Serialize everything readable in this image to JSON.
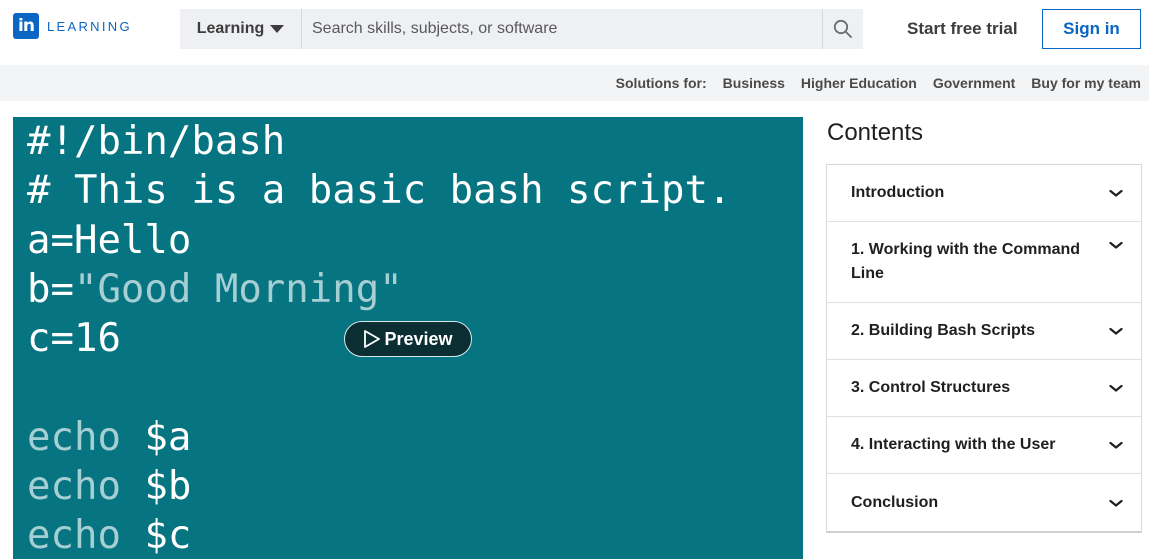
{
  "brand": {
    "logo_mark": "in",
    "logo_word": "LEARNING",
    "accent": "#0a66c2"
  },
  "search": {
    "category": "Learning",
    "placeholder": "Search skills, subjects, or software",
    "icon": "search-icon"
  },
  "header": {
    "start_trial": "Start free trial",
    "sign_in": "Sign in"
  },
  "solutions": {
    "label": "Solutions for:",
    "links": [
      "Business",
      "Higher Education",
      "Government",
      "Buy for my team"
    ]
  },
  "video": {
    "background": "#077481",
    "code_lines": [
      {
        "parts": [
          {
            "text": "#!/bin/bash",
            "dim": false
          }
        ]
      },
      {
        "parts": [
          {
            "text": "# This is a basic bash script.",
            "dim": false
          }
        ]
      },
      {
        "parts": [
          {
            "text": "a=Hello",
            "dim": false
          }
        ]
      },
      {
        "parts": [
          {
            "text": "b=",
            "dim": false
          },
          {
            "text": "\"Good Morning\"",
            "dim": true
          }
        ]
      },
      {
        "parts": [
          {
            "text": "c=16",
            "dim": false
          }
        ]
      },
      {
        "parts": [
          {
            "text": "",
            "dim": false
          }
        ]
      },
      {
        "parts": [
          {
            "text": "echo ",
            "dim": true
          },
          {
            "text": "$a",
            "dim": false
          }
        ]
      },
      {
        "parts": [
          {
            "text": "echo ",
            "dim": true
          },
          {
            "text": "$b",
            "dim": false
          }
        ]
      },
      {
        "parts": [
          {
            "text": "echo ",
            "dim": true
          },
          {
            "text": "$c",
            "dim": false
          }
        ]
      }
    ],
    "preview_label": "Preview"
  },
  "contents": {
    "title": "Contents",
    "items": [
      {
        "label": "Introduction",
        "tall": false
      },
      {
        "label": "1. Working with the Command Line",
        "tall": true
      },
      {
        "label": "2. Building Bash Scripts",
        "tall": false
      },
      {
        "label": "3. Control Structures",
        "tall": false
      },
      {
        "label": "4. Interacting with the User",
        "tall": false
      },
      {
        "label": "Conclusion",
        "tall": false
      }
    ]
  }
}
